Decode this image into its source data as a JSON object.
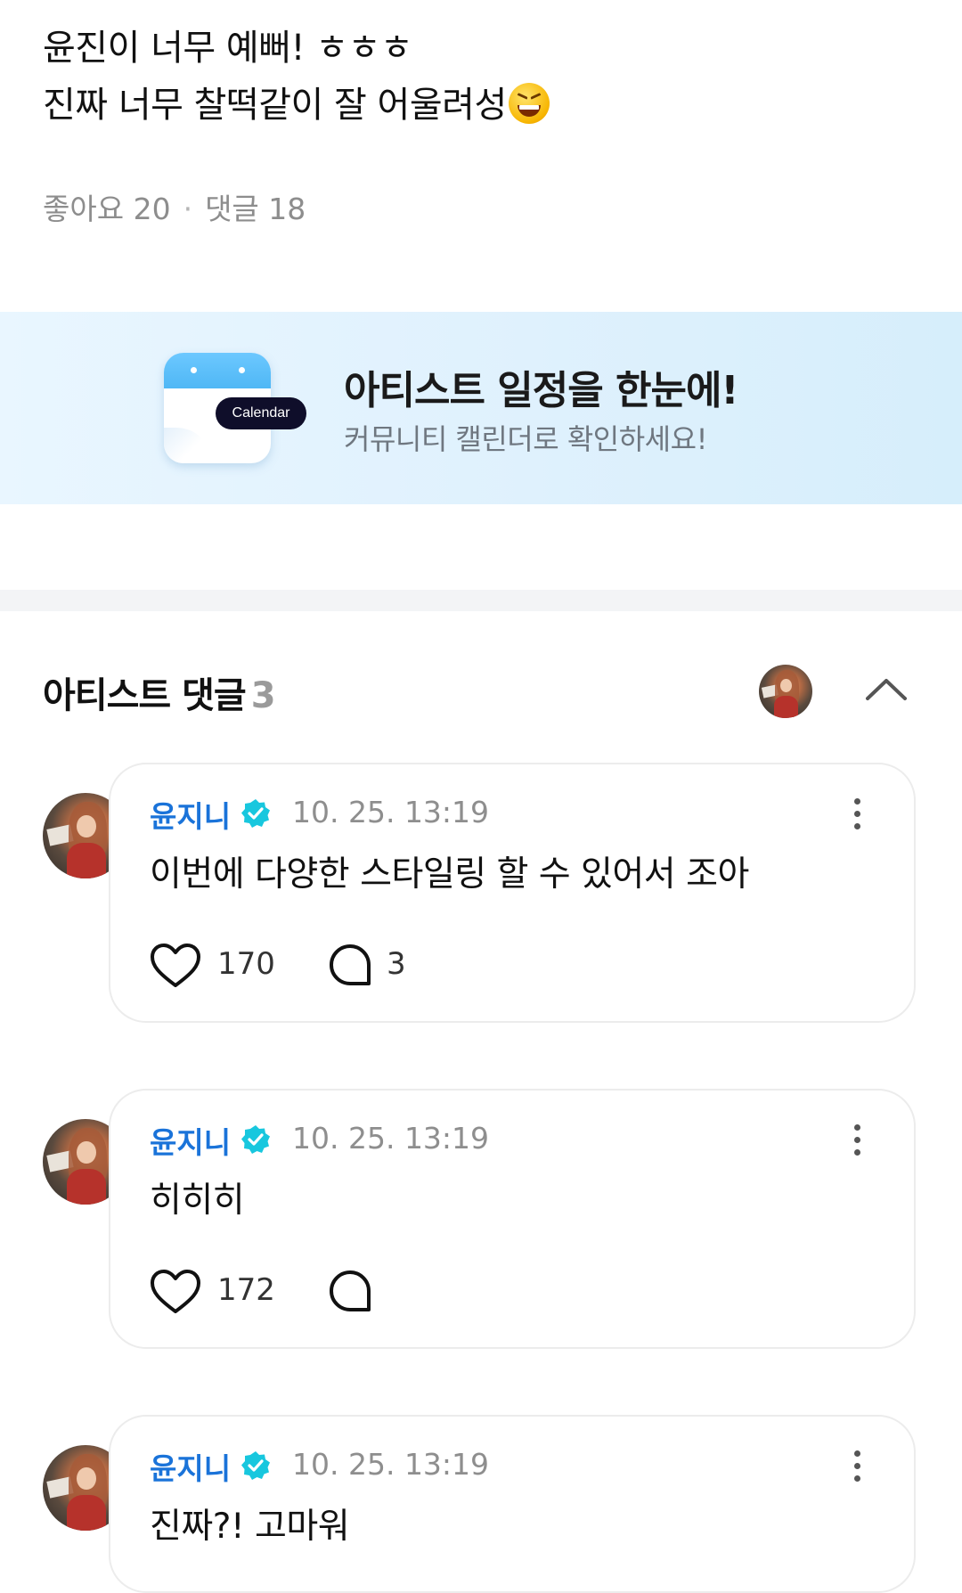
{
  "post": {
    "line1": "윤진이 너무 예뻐! ㅎㅎㅎ",
    "line2": "진짜 너무 찰떡같이 잘 어울려성",
    "emoji": "grinning-squinting-face-emoji",
    "likes_label": "좋아요 20",
    "comments_label": "댓글 18",
    "separator": "·"
  },
  "banner": {
    "tag": "Calendar",
    "title": "아티스트 일정을 한눈에!",
    "subtitle": "커뮤니티 캘린더로 확인하세요!",
    "icon": "calendar-icon"
  },
  "section": {
    "title": "아티스트 댓글",
    "count": "3",
    "collapse_icon": "chevron-up-icon"
  },
  "comments": [
    {
      "author": "윤지니",
      "time": "10. 25. 13:19",
      "text": "이번에 다양한 스타일링 할 수 있어서 조아",
      "likes": "170",
      "replies": "3"
    },
    {
      "author": "윤지니",
      "time": "10. 25. 13:19",
      "text": "히히히",
      "likes": "172",
      "replies": ""
    },
    {
      "author": "윤지니",
      "time": "10. 25. 13:19",
      "text": "진짜?! 고마워",
      "likes": "",
      "replies": ""
    }
  ],
  "colors": {
    "author": "#1a73d9",
    "verified": "#18c7de",
    "banner_bg": "#e3f3fd",
    "divider": "#f3f4f6"
  }
}
